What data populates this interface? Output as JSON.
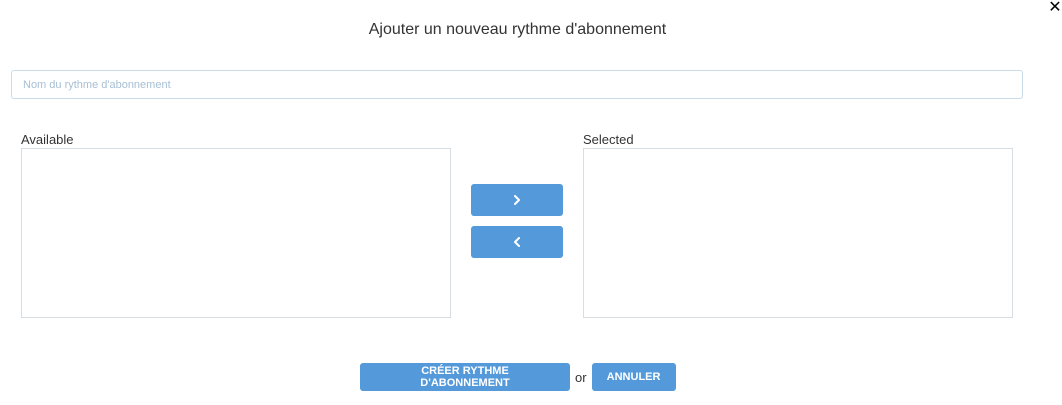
{
  "dialog": {
    "title": "Ajouter un nouveau rythme d'abonnement",
    "close_icon": "close-icon"
  },
  "name_field": {
    "placeholder": "Nom du rythme d'abonnement",
    "value": ""
  },
  "lists": {
    "available_label": "Available",
    "selected_label": "Selected",
    "available_items": [],
    "selected_items": []
  },
  "transfer": {
    "move_right_icon": "chevron-right-icon",
    "move_left_icon": "chevron-left-icon"
  },
  "footer": {
    "create_label": "CRÉER RYTHME D'ABONNEMENT",
    "or_text": "or",
    "cancel_label": "ANNULER"
  },
  "colors": {
    "primary": "#5499da",
    "input_border": "#c9dbe8",
    "list_border": "#d6dde3",
    "text": "#333333"
  }
}
